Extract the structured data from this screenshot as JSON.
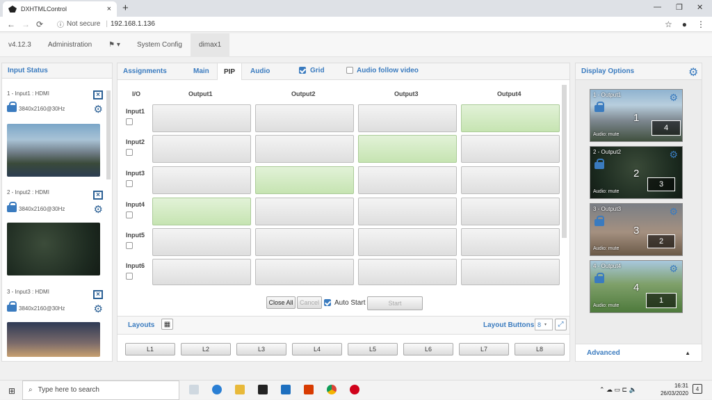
{
  "browser": {
    "tab_title": "DXHTMLControl",
    "tab_close": "×",
    "new_tab": "+",
    "minimize": "—",
    "restore": "❐",
    "close": "✕",
    "not_secure": "Not secure",
    "url": "192.168.1.136"
  },
  "menubar": {
    "version": "v4.12.3",
    "administration": "Administration",
    "lang": "⚑ ▾",
    "system_config": "System Config",
    "device": "dimax1"
  },
  "input_status": {
    "title": "Input Status",
    "inputs": [
      {
        "label": "1 - Input1 : HDMI",
        "resolution": "3840x2160@30Hz"
      },
      {
        "label": "2 - Input2 : HDMI",
        "resolution": "3840x2160@30Hz"
      },
      {
        "label": "3 - Input3 : HDMI",
        "resolution": "3840x2160@30Hz"
      }
    ]
  },
  "assignments": {
    "title": "Assignments",
    "tabs": [
      "Main",
      "PIP",
      "Audio"
    ],
    "active_tab": "PIP",
    "grid_label": "Grid",
    "grid_checked": true,
    "audio_follow_label": "Audio follow video",
    "audio_follow_checked": false,
    "corner": "I/O",
    "outputs": [
      "Output1",
      "Output2",
      "Output3",
      "Output4"
    ],
    "inputs": [
      "Input1",
      "Input2",
      "Input3",
      "Input4",
      "Input5",
      "Input6"
    ],
    "active": [
      [
        0,
        0,
        0,
        1
      ],
      [
        0,
        0,
        1,
        0
      ],
      [
        0,
        1,
        0,
        0
      ],
      [
        1,
        0,
        0,
        0
      ],
      [
        0,
        0,
        0,
        0
      ],
      [
        0,
        0,
        0,
        0
      ]
    ],
    "close_all": "Close All",
    "cancel": "Cancel",
    "auto_start": "Auto Start",
    "start": "Start"
  },
  "layouts": {
    "title": "Layouts",
    "buttons_label": "Layout Buttons:",
    "buttons_value": "8",
    "items": [
      "L1",
      "L2",
      "L3",
      "L4",
      "L5",
      "L6",
      "L7",
      "L8"
    ]
  },
  "display_options": {
    "title": "Display Options",
    "advanced": "Advanced",
    "outputs": [
      {
        "title": "1 - Output1",
        "audio": "Audio: mute",
        "main": "1",
        "pip": "4"
      },
      {
        "title": "2 - Output2",
        "audio": "Audio: mute",
        "main": "2",
        "pip": "3"
      },
      {
        "title": "3 - Output3",
        "audio": "Audio: mute",
        "main": "3",
        "pip": "2"
      },
      {
        "title": "4 - Output4",
        "audio": "Audio: mute",
        "main": "4",
        "pip": "1"
      }
    ]
  },
  "taskbar": {
    "search_placeholder": "Type here to search",
    "time": "16:31",
    "date": "26/03/2020",
    "notif": "4"
  }
}
